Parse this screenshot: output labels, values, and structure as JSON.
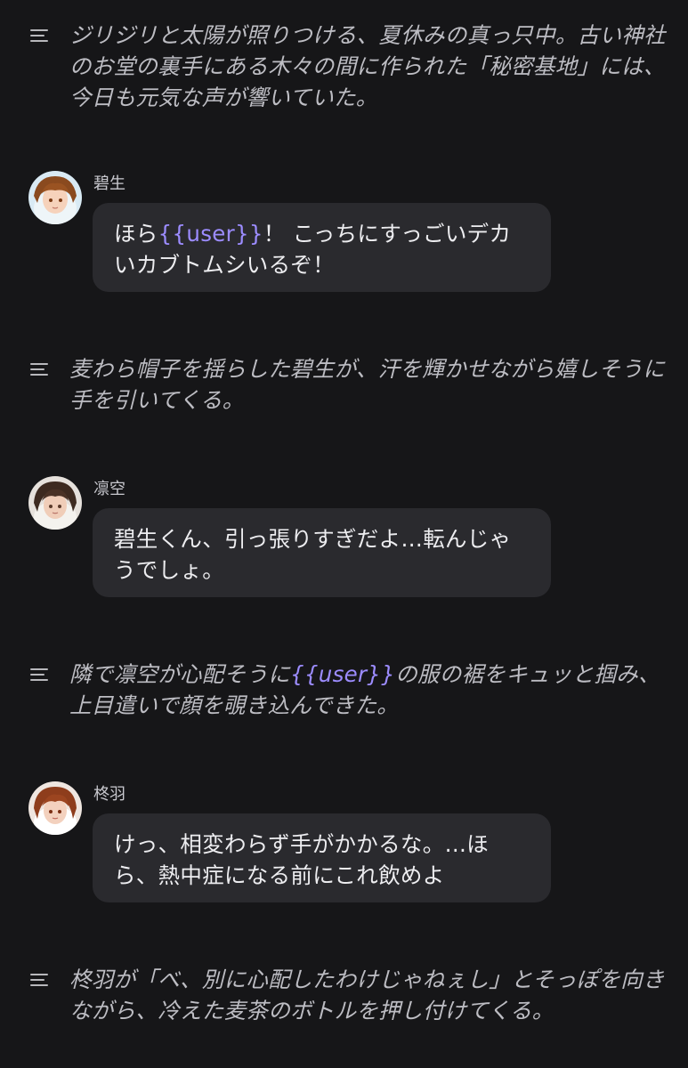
{
  "narrations": [
    {
      "text": "ジリジリと太陽が照りつける、夏休みの真っ只中。古い神社のお堂の裏手にある木々の間に作られた「秘密基地」には、今日も元気な声が響いていた。"
    },
    {
      "text": "麦わら帽子を揺らした碧生が、汗を輝かせながら嬉しそうに手を引いてくる。"
    },
    {
      "before": "隣で凛空が心配そうに",
      "tag": "{{user}}",
      "after": "の服の裾をキュッと掴み、上目遣いで顔を覗き込んできた。"
    },
    {
      "text": "柊羽が「べ、別に心配したわけじゃねぇし」とそっぽを向きながら、冷えた麦茶のボトルを押し付けてくる。"
    }
  ],
  "messages": [
    {
      "speaker": "碧生",
      "before": "ほら",
      "tag": "{{user}}",
      "after": "！ こっちにすっごいデカいカブトムシいるぞ！"
    },
    {
      "speaker": "凛空",
      "text": "碧生くん、引っ張りすぎだよ…転んじゃうでしょ。"
    },
    {
      "speaker": "柊羽",
      "text": "けっ、相変わらず手がかかるな。…ほら、熱中症になる前にこれ飲めよ"
    }
  ],
  "colors": {
    "background": "#161618",
    "bubble": "#2a2a2e",
    "narration_text": "#bdbdc3",
    "user_tag": "#9c8cff"
  },
  "icons": {
    "narration": "text-lines-icon",
    "avatar": "character-portrait"
  }
}
